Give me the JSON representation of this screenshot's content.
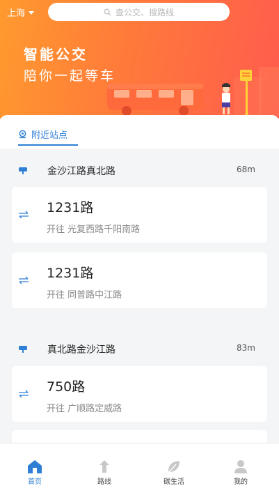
{
  "header": {
    "city": "上海",
    "search_placeholder": "查公交、搜路线"
  },
  "banner": {
    "slogan_line1": "智能公交",
    "slogan_line2": "陪你一起等车"
  },
  "tabs": {
    "nearby": "附近站点"
  },
  "stations": [
    {
      "name": "金沙江路真北路",
      "distance": "68m",
      "routes": [
        {
          "route": "1231路",
          "direction": "开往 光复西路千阳南路"
        },
        {
          "route": "1231路",
          "direction": "开往 同普路中江路"
        }
      ]
    },
    {
      "name": "真北路金沙江路",
      "distance": "83m",
      "routes": [
        {
          "route": "750路",
          "direction": "开往 广顺路定威路"
        }
      ]
    }
  ],
  "bottom_nav": [
    {
      "label": "首页",
      "icon": "home-icon",
      "active": true
    },
    {
      "label": "路线",
      "icon": "route-icon",
      "active": false
    },
    {
      "label": "碳生活",
      "icon": "leaf-icon",
      "active": false
    },
    {
      "label": "我的",
      "icon": "user-icon",
      "active": false
    }
  ],
  "colors": {
    "accent": "#2f7fd6",
    "banner_start": "#ff9a2e",
    "banner_end": "#ff5c4d"
  }
}
